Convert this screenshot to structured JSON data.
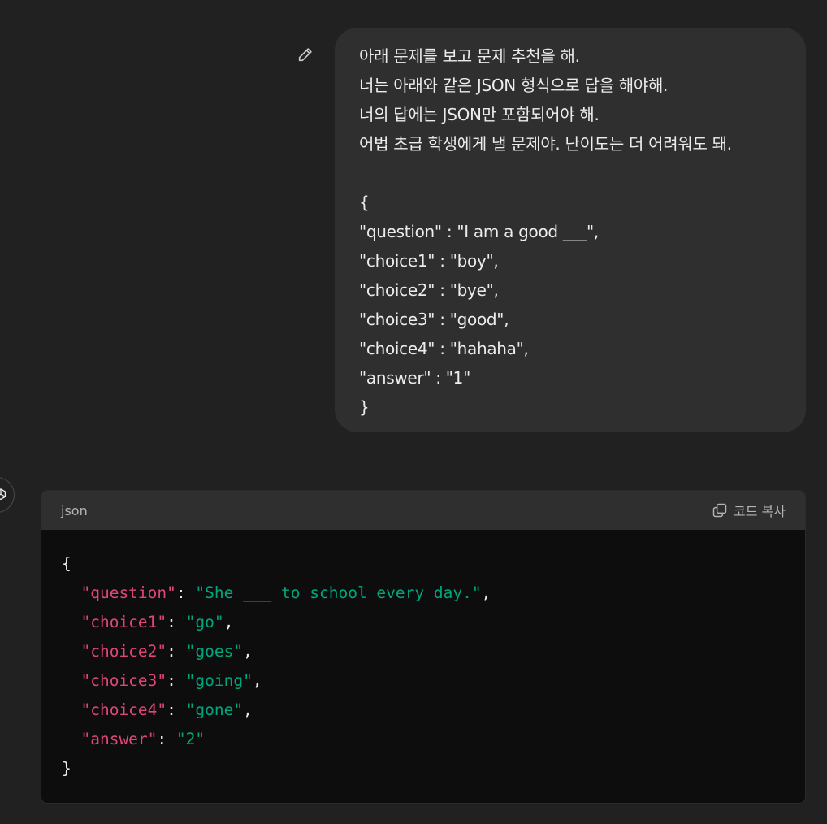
{
  "user_message": {
    "lines": [
      "아래 문제를 보고 문제 추천을 해.",
      "너는 아래와 같은 JSON 형식으로 답을 해야해.",
      "너의 답에는 JSON만 포함되어야 해.",
      "어법 초급 학생에게 낼 문제야. 난이도는 더 어려워도 돼.",
      "",
      "{",
      "\"question\" : \"I am a good ___\",",
      "\"choice1\" : \"boy\",",
      "\"choice2\" : \"bye\",",
      "\"choice3\" : \"good\",",
      "\"choice4\" : \"hahaha\",",
      "\"answer\" : \"1\"",
      "}"
    ],
    "edit_icon": "pencil-icon"
  },
  "assistant": {
    "avatar_icon": "openai-logo-icon",
    "code_block": {
      "language": "json",
      "copy_label": "코드 복사",
      "copy_icon": "copy-icon",
      "code": {
        "open": "{",
        "entries": [
          {
            "key": "\"question\"",
            "value": "\"She ___ to school every day.\"",
            "comma": ","
          },
          {
            "key": "\"choice1\"",
            "value": "\"go\"",
            "comma": ","
          },
          {
            "key": "\"choice2\"",
            "value": "\"goes\"",
            "comma": ","
          },
          {
            "key": "\"choice3\"",
            "value": "\"going\"",
            "comma": ","
          },
          {
            "key": "\"choice4\"",
            "value": "\"gone\"",
            "comma": ","
          },
          {
            "key": "\"answer\"",
            "value": "\"2\"",
            "comma": ""
          }
        ],
        "close": "}"
      }
    }
  },
  "colors": {
    "background": "#212121",
    "bubble": "#2f2f2f",
    "code_bg": "#0d0d0d",
    "json_key": "#e0457b",
    "json_string": "#00a67d"
  }
}
